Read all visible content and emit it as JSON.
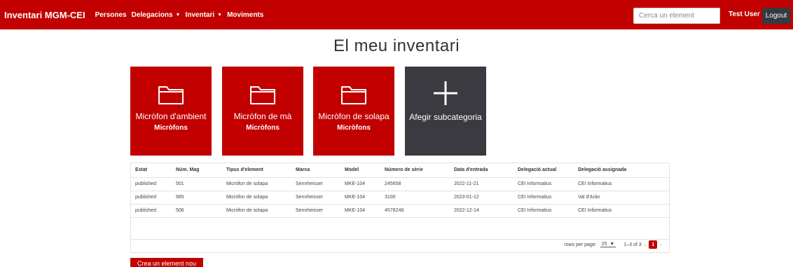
{
  "navbar": {
    "brand": "Inventari MGM-CEI",
    "links": [
      {
        "label": "Persones",
        "dropdown": false
      },
      {
        "label": "Delegacions",
        "dropdown": true
      },
      {
        "label": "Inventari",
        "dropdown": true
      },
      {
        "label": "Moviments",
        "dropdown": false
      }
    ],
    "search_placeholder": "Cerca un element",
    "user": "Test User",
    "logout": "Logout",
    "accent_color": "#c20000"
  },
  "page_title": "El meu inventari",
  "cards": [
    {
      "name": "Micròfon d'ambient",
      "category": "Micròfons",
      "icon": "folder-icon"
    },
    {
      "name": "Micròfon de mà",
      "category": "Micròfons",
      "icon": "folder-icon"
    },
    {
      "name": "Micròfon de solapa",
      "category": "Micròfons",
      "icon": "folder-icon"
    },
    {
      "name": "Afegir subcategoria",
      "category": "",
      "icon": "plus-icon"
    }
  ],
  "table": {
    "headers": [
      "Estat",
      "Núm. Mag",
      "Tipus d'element",
      "Marca",
      "Model",
      "Número de sèrie",
      "Data d'entrada",
      "Delegació actual",
      "Delegació assignada"
    ],
    "rows": [
      [
        "published",
        "501",
        "Micròfon de solapa",
        "Sennheisser",
        "MKE-104",
        "245658",
        "2022-11-21",
        "CEI Informatius",
        "CEI Informatius"
      ],
      [
        "published",
        "985",
        "Micròfon de solapa",
        "Sennheisser",
        "MKE-104",
        "3100",
        "2023-01-12",
        "CEI Informatius",
        "Val d'Arán"
      ],
      [
        "published",
        "506",
        "Micròfon de solapa",
        "Sennheisser",
        "MKE-104",
        "4578248",
        "2022-12-14",
        "CEI Informatius",
        "CEI Informatius"
      ]
    ],
    "pagination": {
      "rows_per_page_label": "rows per page:",
      "rows_per_page": "25",
      "range": "1–3 of 3",
      "current_page": "1"
    }
  },
  "create_button": "Crea un element nou"
}
